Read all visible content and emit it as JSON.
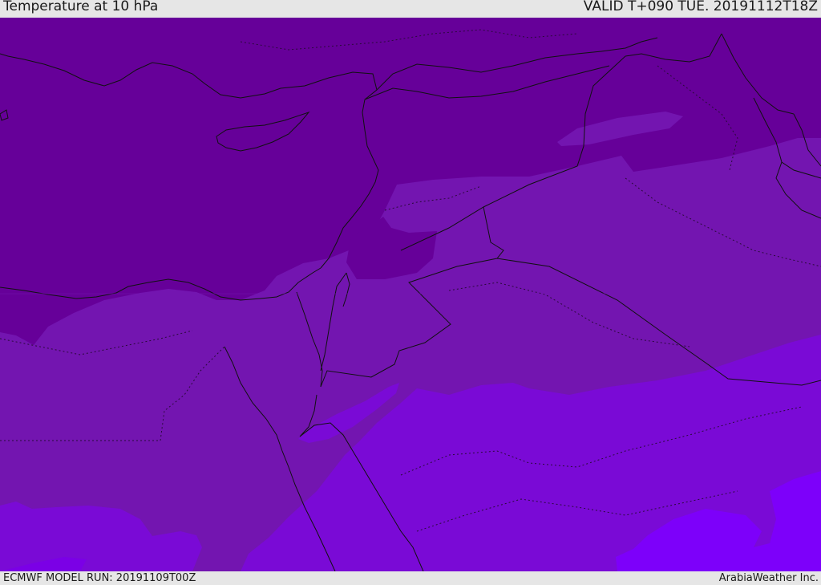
{
  "header": {
    "title": "Temperature at 10 hPa",
    "valid": "VALID T+090 TUE. 20191112T18Z"
  },
  "footer": {
    "model_run": "ECMWF MODEL RUN: 20191109T00Z",
    "brand": "ArabiaWeather Inc."
  },
  "map": {
    "field": "temperature-10hPa",
    "colors": {
      "band_1": "#660099",
      "band_2": "#7315b0",
      "band_3": "#7a0ad6",
      "band_4": "#7b00e6",
      "band_5": "#7d00fa",
      "coastline": "#111111",
      "border": "#111111",
      "admin_border": "#2a0a3a"
    }
  }
}
